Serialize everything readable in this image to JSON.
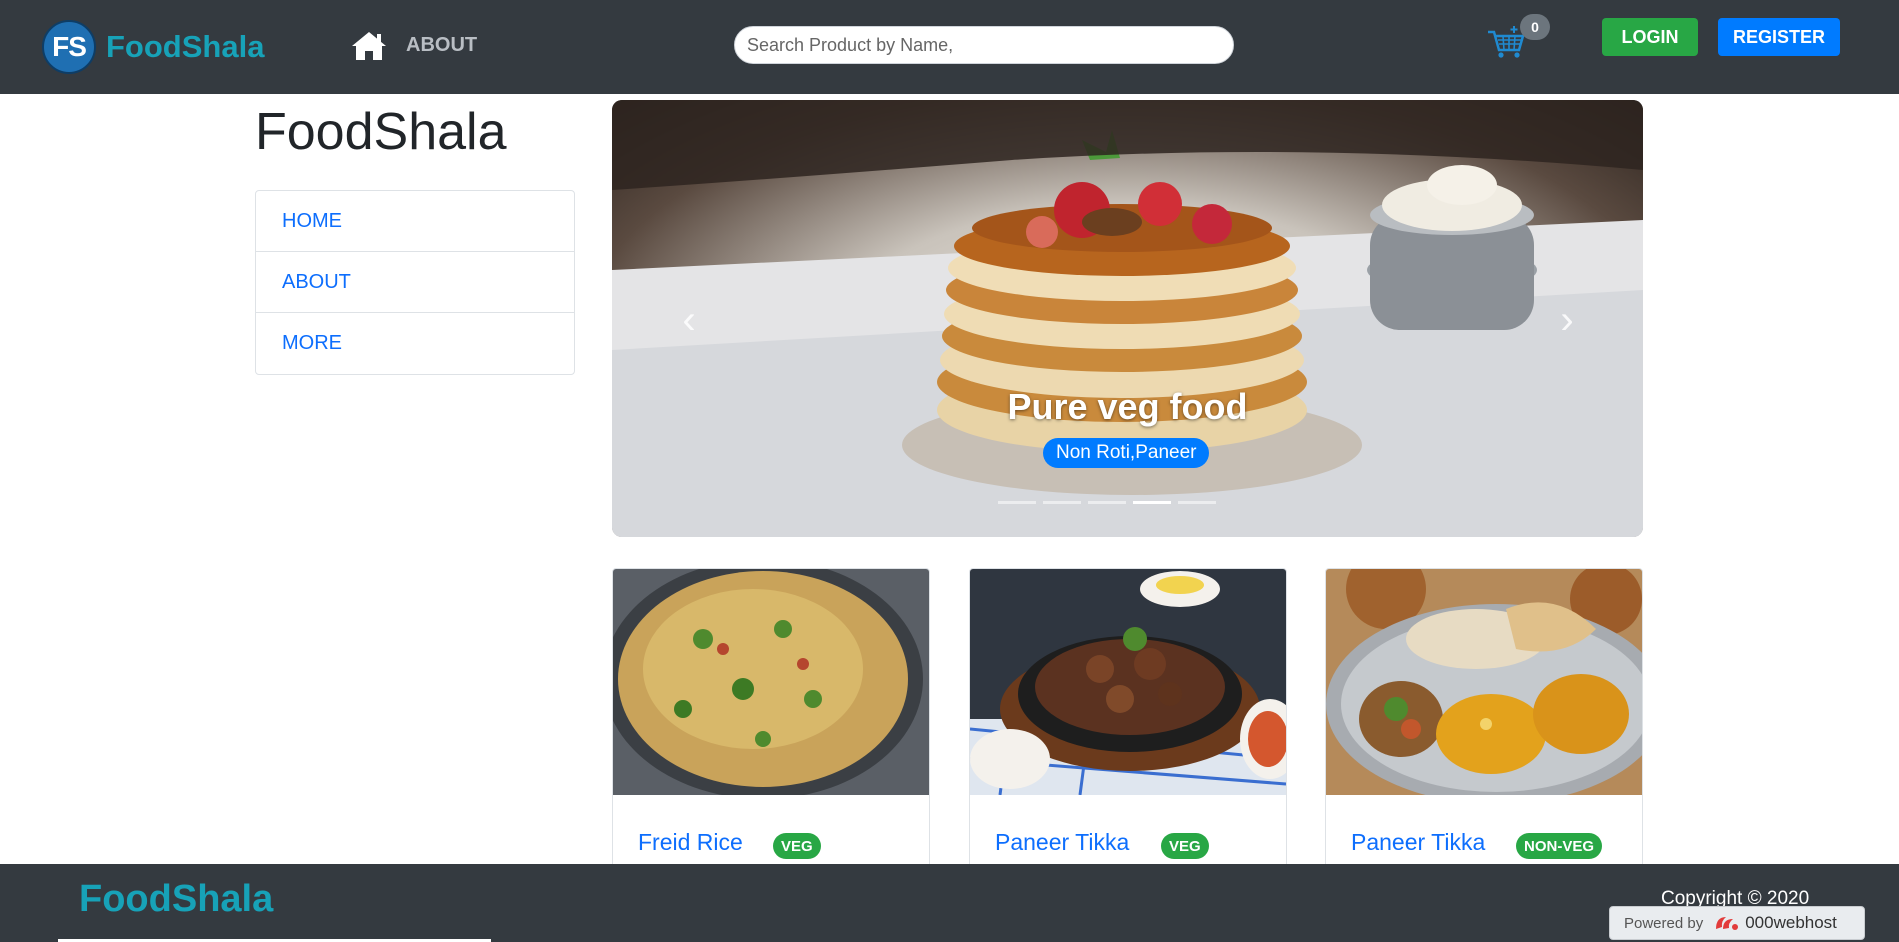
{
  "header": {
    "logo_text": "FS",
    "brand": "FoodShala",
    "about_label": "ABOUT",
    "search_placeholder": "Search Product by Name,",
    "cart_count": "0",
    "login_label": "LOGIN",
    "register_label": "REGISTER",
    "colors": {
      "bar": "#343a40",
      "brand": "#17a2b8",
      "login": "#28a745",
      "register": "#007bff"
    }
  },
  "sidebar": {
    "title": "FoodShala",
    "items": [
      {
        "label": "HOME"
      },
      {
        "label": "ABOUT"
      },
      {
        "label": "MORE"
      }
    ]
  },
  "carousel": {
    "caption": "Pure veg food",
    "badge": "Non Roti,Paneer",
    "slide_count": 5,
    "active_index": 3
  },
  "cards": [
    {
      "title": "Freid Rice",
      "badge": "VEG",
      "image_icon": "biryani-image"
    },
    {
      "title": "Paneer Tikka",
      "badge": "VEG",
      "image_icon": "sizzler-image"
    },
    {
      "title": "Paneer Tikka",
      "badge": "NON-VEG",
      "image_icon": "thali-image"
    }
  ],
  "footer": {
    "brand": "FoodShala",
    "copyright": "Copyright © 2020",
    "powered_by": "Powered by",
    "host_name": "000webhost"
  }
}
